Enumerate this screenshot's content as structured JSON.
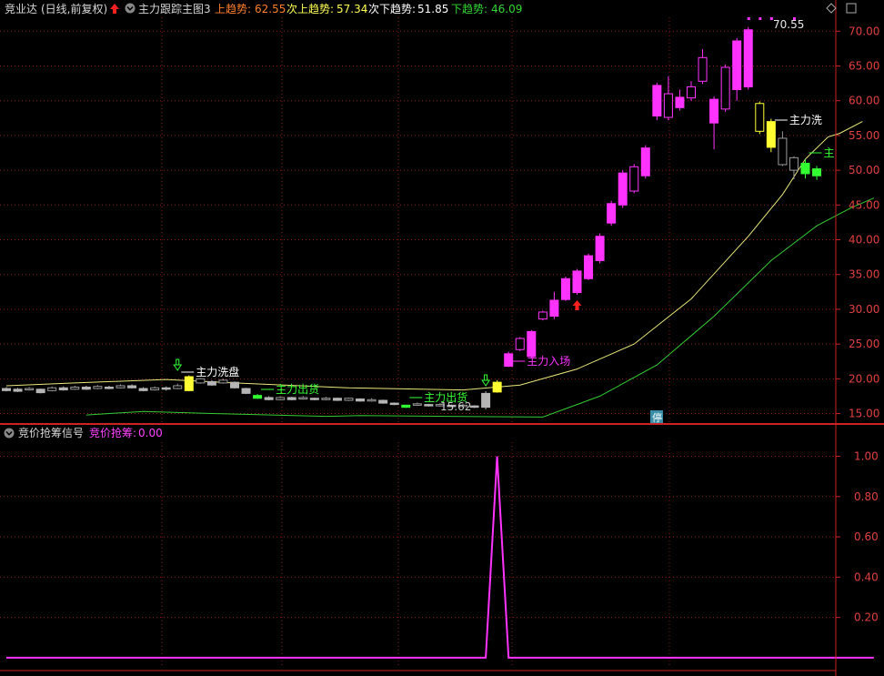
{
  "top_header": {
    "stock_name": "竞业达",
    "period": "(日线,前复权)",
    "indicator_name": "主力跟踪主图3",
    "items": [
      {
        "label": "上趋势:",
        "value": "62.55",
        "color": "#ff7f2a"
      },
      {
        "label": "次上趋势:",
        "value": "57.34",
        "color": "#ffff54"
      },
      {
        "label": "次下趋势:",
        "value": "51.85",
        "color": "#ffffff"
      },
      {
        "label": "下趋势:",
        "value": "46.09",
        "color": "#33d633"
      }
    ]
  },
  "bottom_header": {
    "indicator_name": "竞价抢筹信号",
    "label": "竞价抢筹:",
    "value": "0.00"
  },
  "markers": {
    "max_price": "70.55",
    "min_price": "15.62",
    "stop_badge": "停"
  },
  "annotations": [
    {
      "text": "主力洗盘",
      "color": "#ffffff",
      "idx": 15
    },
    {
      "text": "主力出货",
      "color": "#33ff33",
      "idx": 22
    },
    {
      "text": "主力出货",
      "color": "#33ff33",
      "idx": 35
    },
    {
      "text": "主力入场",
      "color": "#ff33ff",
      "idx": 44
    },
    {
      "text": "主力洗",
      "color": "#ffffff",
      "idx": 67
    },
    {
      "text": "主",
      "color": "#33ff33",
      "idx": 70
    }
  ],
  "colors": {
    "grid": "#8c1a1a",
    "axis": "#cc2222",
    "up_candle": "#ff33ff",
    "neutral_candle": "#9a9a9a",
    "yellow_candle": "#ffff33",
    "green_candle": "#33ff33",
    "ma_upper": "#e8e87a",
    "ma_lower": "#33cc33",
    "signal_line": "#ff33ff"
  },
  "chart_data": [
    {
      "type": "candlestick",
      "title": "主力跟踪主图3",
      "ylim": [
        13.5,
        72
      ],
      "yticks": [
        15,
        20,
        25,
        30,
        35,
        40,
        45,
        50,
        55,
        60,
        65,
        70
      ],
      "ytick_labels": [
        "15.00",
        "20.00",
        "25.00",
        "30.00",
        "35.00",
        "40.00",
        "45.00",
        "50.00",
        "55.00",
        "60.00",
        "65.00",
        "70.00"
      ],
      "candles": [
        {
          "o": 18.6,
          "c": 18.3,
          "h": 18.8,
          "l": 18.2,
          "k": "g"
        },
        {
          "o": 18.5,
          "c": 18.2,
          "h": 18.7,
          "l": 18.1,
          "k": "g"
        },
        {
          "o": 18.4,
          "c": 18.6,
          "h": 18.8,
          "l": 18.3,
          "k": "n"
        },
        {
          "o": 18.5,
          "c": 18.0,
          "h": 18.6,
          "l": 17.9,
          "k": "g"
        },
        {
          "o": 18.3,
          "c": 18.7,
          "h": 18.9,
          "l": 18.2,
          "k": "n"
        },
        {
          "o": 18.7,
          "c": 18.4,
          "h": 18.9,
          "l": 18.3,
          "k": "g"
        },
        {
          "o": 18.5,
          "c": 18.8,
          "h": 19.0,
          "l": 18.4,
          "k": "n"
        },
        {
          "o": 18.8,
          "c": 18.5,
          "h": 19.0,
          "l": 18.4,
          "k": "g"
        },
        {
          "o": 18.6,
          "c": 18.9,
          "h": 19.1,
          "l": 18.5,
          "k": "n"
        },
        {
          "o": 18.8,
          "c": 18.6,
          "h": 19.0,
          "l": 18.5,
          "k": "g"
        },
        {
          "o": 18.7,
          "c": 19.0,
          "h": 19.2,
          "l": 18.6,
          "k": "n"
        },
        {
          "o": 19.0,
          "c": 18.7,
          "h": 19.2,
          "l": 18.6,
          "k": "g"
        },
        {
          "o": 18.6,
          "c": 18.3,
          "h": 18.8,
          "l": 18.2,
          "k": "g"
        },
        {
          "o": 18.4,
          "c": 18.7,
          "h": 18.9,
          "l": 18.3,
          "k": "n"
        },
        {
          "o": 18.7,
          "c": 18.5,
          "h": 18.9,
          "l": 18.3,
          "k": "g"
        },
        {
          "o": 18.6,
          "c": 19.0,
          "h": 19.3,
          "l": 18.5,
          "k": "n"
        },
        {
          "o": 18.3,
          "c": 20.3,
          "h": 20.5,
          "l": 18.2,
          "k": "y"
        },
        {
          "o": 20.0,
          "c": 19.4,
          "h": 20.1,
          "l": 19.3,
          "k": "n"
        },
        {
          "o": 19.6,
          "c": 19.1,
          "h": 19.8,
          "l": 19.0,
          "k": "g"
        },
        {
          "o": 19.4,
          "c": 19.8,
          "h": 20.0,
          "l": 19.3,
          "k": "n"
        },
        {
          "o": 19.5,
          "c": 18.7,
          "h": 19.6,
          "l": 18.6,
          "k": "g"
        },
        {
          "o": 18.6,
          "c": 17.9,
          "h": 18.7,
          "l": 17.8,
          "k": "g"
        },
        {
          "o": 17.6,
          "c": 17.2,
          "h": 17.8,
          "l": 17.1,
          "k": "gg"
        },
        {
          "o": 17.3,
          "c": 17.0,
          "h": 17.5,
          "l": 16.9,
          "k": "g"
        },
        {
          "o": 17.0,
          "c": 17.3,
          "h": 17.5,
          "l": 16.9,
          "k": "n"
        },
        {
          "o": 17.3,
          "c": 17.0,
          "h": 17.4,
          "l": 16.9,
          "k": "g"
        },
        {
          "o": 17.1,
          "c": 17.3,
          "h": 17.5,
          "l": 17.0,
          "k": "n"
        },
        {
          "o": 17.2,
          "c": 17.0,
          "h": 17.3,
          "l": 16.9,
          "k": "g"
        },
        {
          "o": 17.0,
          "c": 17.2,
          "h": 17.4,
          "l": 16.9,
          "k": "n"
        },
        {
          "o": 17.2,
          "c": 16.9,
          "h": 17.3,
          "l": 16.8,
          "k": "g"
        },
        {
          "o": 16.9,
          "c": 17.2,
          "h": 17.3,
          "l": 16.8,
          "k": "n"
        },
        {
          "o": 17.1,
          "c": 16.8,
          "h": 17.2,
          "l": 16.7,
          "k": "g"
        },
        {
          "o": 16.8,
          "c": 17.0,
          "h": 17.2,
          "l": 16.7,
          "k": "n"
        },
        {
          "o": 16.9,
          "c": 16.5,
          "h": 17.0,
          "l": 16.4,
          "k": "g"
        },
        {
          "o": 16.5,
          "c": 16.3,
          "h": 16.6,
          "l": 16.2,
          "k": "g"
        },
        {
          "o": 16.2,
          "c": 15.9,
          "h": 16.3,
          "l": 15.8,
          "k": "gg"
        },
        {
          "o": 16.2,
          "c": 16.4,
          "h": 16.6,
          "l": 16.1,
          "k": "n"
        },
        {
          "o": 16.3,
          "c": 16.1,
          "h": 16.4,
          "l": 16.0,
          "k": "g"
        },
        {
          "o": 16.1,
          "c": 16.3,
          "h": 16.5,
          "l": 16.0,
          "k": "n"
        },
        {
          "o": 16.2,
          "c": 16.0,
          "h": 16.3,
          "l": 15.9,
          "k": "g"
        },
        {
          "o": 16.0,
          "c": 16.2,
          "h": 16.4,
          "l": 15.9,
          "k": "n"
        },
        {
          "o": 16.1,
          "c": 15.9,
          "h": 16.2,
          "l": 15.8,
          "k": "g"
        },
        {
          "o": 15.9,
          "c": 17.9,
          "h": 18.2,
          "l": 15.6,
          "k": "g"
        },
        {
          "o": 18.1,
          "c": 19.5,
          "h": 19.8,
          "l": 18.0,
          "k": "y"
        },
        {
          "o": 21.8,
          "c": 23.6,
          "h": 23.9,
          "l": 21.7,
          "k": "u"
        },
        {
          "o": 24.2,
          "c": 25.8,
          "h": 26.0,
          "l": 24.0,
          "k": "uh"
        },
        {
          "o": 23.2,
          "c": 26.8,
          "h": 27.0,
          "l": 23.0,
          "k": "u"
        },
        {
          "o": 28.6,
          "c": 29.6,
          "h": 29.8,
          "l": 28.4,
          "k": "uh"
        },
        {
          "o": 29.0,
          "c": 31.3,
          "h": 32.5,
          "l": 28.6,
          "k": "u"
        },
        {
          "o": 31.4,
          "c": 34.4,
          "h": 34.7,
          "l": 31.2,
          "k": "u"
        },
        {
          "o": 32.4,
          "c": 35.5,
          "h": 35.8,
          "l": 32.1,
          "k": "u"
        },
        {
          "o": 34.4,
          "c": 37.7,
          "h": 38.0,
          "l": 34.2,
          "k": "u"
        },
        {
          "o": 37.0,
          "c": 40.5,
          "h": 40.9,
          "l": 36.6,
          "k": "u"
        },
        {
          "o": 42.4,
          "c": 45.2,
          "h": 45.6,
          "l": 42.0,
          "k": "u"
        },
        {
          "o": 45.0,
          "c": 49.6,
          "h": 50.0,
          "l": 44.6,
          "k": "u"
        },
        {
          "o": 47.0,
          "c": 50.5,
          "h": 50.9,
          "l": 46.7,
          "k": "uh"
        },
        {
          "o": 49.2,
          "c": 53.2,
          "h": 53.6,
          "l": 48.8,
          "k": "u"
        },
        {
          "o": 57.8,
          "c": 62.2,
          "h": 62.6,
          "l": 57.2,
          "k": "u"
        },
        {
          "o": 57.6,
          "c": 61.0,
          "h": 63.5,
          "l": 57.2,
          "k": "uh"
        },
        {
          "o": 60.5,
          "c": 59.0,
          "h": 61.6,
          "l": 58.6,
          "k": "u"
        },
        {
          "o": 62.0,
          "c": 60.4,
          "h": 62.8,
          "l": 60.0,
          "k": "uh"
        },
        {
          "o": 62.8,
          "c": 66.2,
          "h": 67.4,
          "l": 62.4,
          "k": "uh"
        },
        {
          "o": 56.8,
          "c": 60.2,
          "h": 60.6,
          "l": 53.0,
          "k": "u"
        },
        {
          "o": 58.8,
          "c": 64.8,
          "h": 65.2,
          "l": 58.4,
          "k": "uh"
        },
        {
          "o": 61.6,
          "c": 68.6,
          "h": 69.0,
          "l": 60.0,
          "k": "u"
        },
        {
          "o": 62.0,
          "c": 70.2,
          "h": 70.6,
          "l": 61.6,
          "k": "u"
        },
        {
          "o": 59.6,
          "c": 55.6,
          "h": 59.9,
          "l": 55.2,
          "k": "yh"
        },
        {
          "o": 57.0,
          "c": 53.3,
          "h": 57.4,
          "l": 52.6,
          "k": "y"
        },
        {
          "o": 54.6,
          "c": 50.8,
          "h": 55.6,
          "l": 50.6,
          "k": "n"
        },
        {
          "o": 51.8,
          "c": 50.0,
          "h": 52.0,
          "l": 48.7,
          "k": "n"
        },
        {
          "o": 51.0,
          "c": 49.5,
          "h": 51.6,
          "l": 48.8,
          "k": "gg"
        },
        {
          "o": 50.2,
          "c": 49.2,
          "h": 50.6,
          "l": 48.6,
          "k": "gg"
        }
      ],
      "ma_upper": [
        [
          0,
          19.0
        ],
        [
          6,
          19.4
        ],
        [
          14,
          19.9
        ],
        [
          20,
          19.4
        ],
        [
          30,
          18.7
        ],
        [
          40,
          18.4
        ],
        [
          45,
          19.1
        ],
        [
          50,
          21.4
        ],
        [
          55,
          25.0
        ],
        [
          60,
          31.5
        ],
        [
          65,
          40.5
        ],
        [
          68,
          46.5
        ],
        [
          70,
          51.6
        ],
        [
          72,
          54.8
        ],
        [
          73,
          55.3
        ],
        [
          75,
          57.0
        ]
      ],
      "ma_lower": [
        [
          7,
          14.8
        ],
        [
          12,
          15.3
        ],
        [
          18,
          15.0
        ],
        [
          28,
          14.6
        ],
        [
          31,
          14.7
        ],
        [
          47,
          14.5
        ],
        [
          52,
          17.5
        ],
        [
          57,
          22.0
        ],
        [
          62,
          29.0
        ],
        [
          67,
          37.0
        ],
        [
          71,
          42.0
        ],
        [
          74,
          44.6
        ],
        [
          76,
          46.0
        ]
      ]
    },
    {
      "type": "line",
      "title": "竞价抢筹信号",
      "series": [
        {
          "name": "竞价抢筹",
          "values": [
            [
              0,
              0
            ],
            [
              42,
              0
            ],
            [
              43,
              1
            ],
            [
              44,
              0
            ],
            [
              76,
              0
            ]
          ]
        }
      ],
      "ylim": [
        -0.05,
        1.07
      ],
      "yticks": [
        0.2,
        0.4,
        0.6,
        0.8,
        1.0
      ],
      "ytick_labels": [
        "0.20",
        "0.40",
        "0.60",
        "0.80",
        "1.00"
      ]
    }
  ]
}
